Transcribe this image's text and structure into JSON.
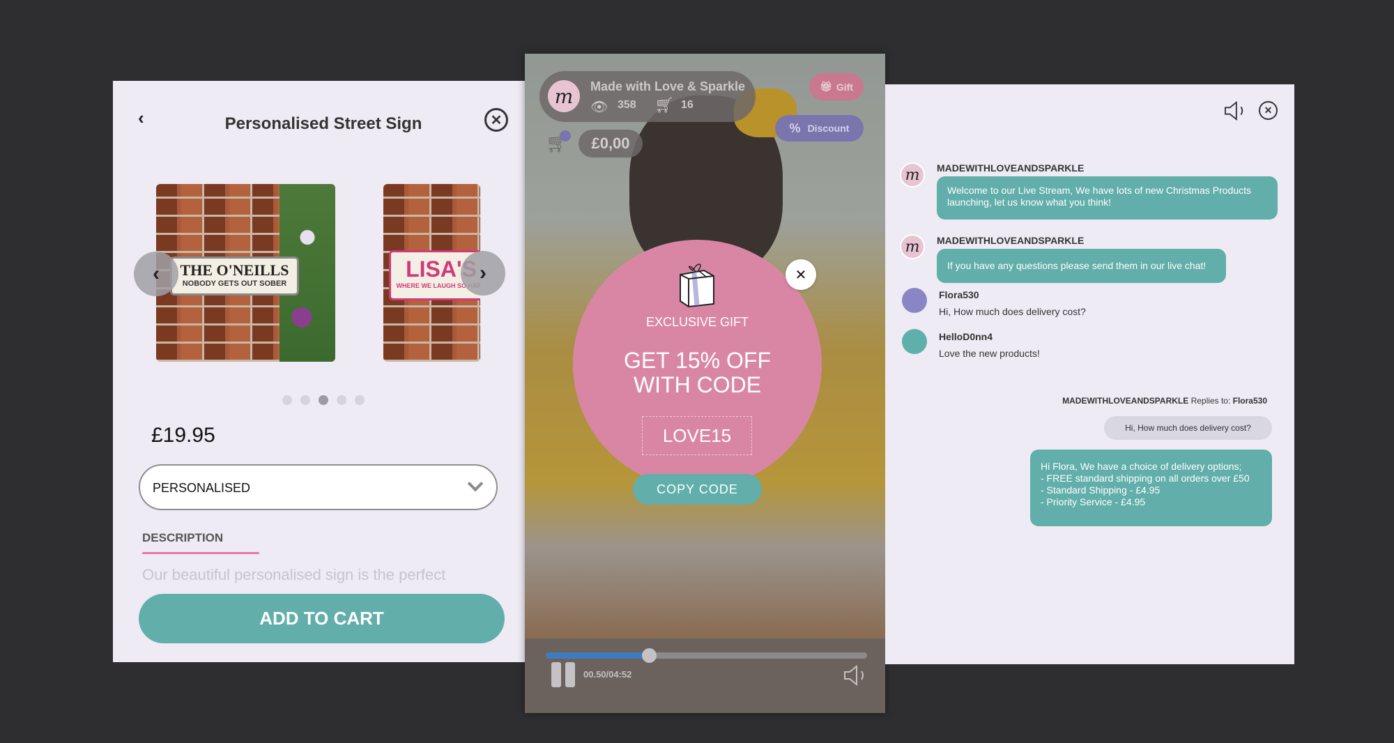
{
  "product": {
    "title": "Personalised Street Sign",
    "sign1": {
      "line1": "THE O'NEILLS",
      "line2": "NOBODY GETS OUT SOBER"
    },
    "sign2": {
      "line1": "LISA'S",
      "line2": "WHERE WE LAUGH SO HARD"
    },
    "carousel_active_index": 2,
    "carousel_count": 5,
    "price": "£19.95",
    "option_selected": "PERSONALISED",
    "description_label": "DESCRIPTION",
    "description_text": "Our beautiful personalised sign is the perfect",
    "add_to_cart": "ADD TO CART",
    "accent": "#62aeaa",
    "pink": "#e07aa0"
  },
  "stream": {
    "shop_name": "Made with Love & Sparkle",
    "avatar_letter": "m",
    "viewers": "358",
    "cart_count": "16",
    "gift_label": "Gift",
    "discount_label": "Discount",
    "cart_total": "£0,00",
    "popup": {
      "eyebrow": "EXCLUSIVE GIFT",
      "headline_1": "GET 15% OFF",
      "headline_2": "WITH CODE",
      "code": "LOVE15",
      "copy_button": "COPY CODE",
      "color": "#d986a5"
    },
    "player": {
      "time": "00.50/04:52",
      "progress": 0.32,
      "state": "playing"
    }
  },
  "chat": {
    "messages": [
      {
        "user": "MADEWITHLOVEANDSPARKLE",
        "text": "Welcome to our Live Stream, We have lots of new Christmas Products launching, let us know what you think!"
      },
      {
        "user": "MADEWITHLOVEANDSPARKLE",
        "text": "If you have any questions please send them in our live chat!"
      },
      {
        "user": "Flora530",
        "text": "Hi, How much does delivery cost?",
        "color": "#8a86c6"
      },
      {
        "user": "HelloD0nn4",
        "text": "Love the new products!",
        "color": "#5fb0ab"
      }
    ],
    "reply": {
      "from": "MADEWITHLOVEANDSPARKLE",
      "replies_to_label": "Replies to:",
      "to": "Flora530",
      "quoted": "Hi, How much does delivery cost?",
      "lines": [
        "Hi Flora, We have a choice of delivery options;",
        "- FREE standard shipping on all orders over £50",
        "- Standard Shipping - £4.95",
        "- Priority Service - £4.95"
      ]
    }
  }
}
